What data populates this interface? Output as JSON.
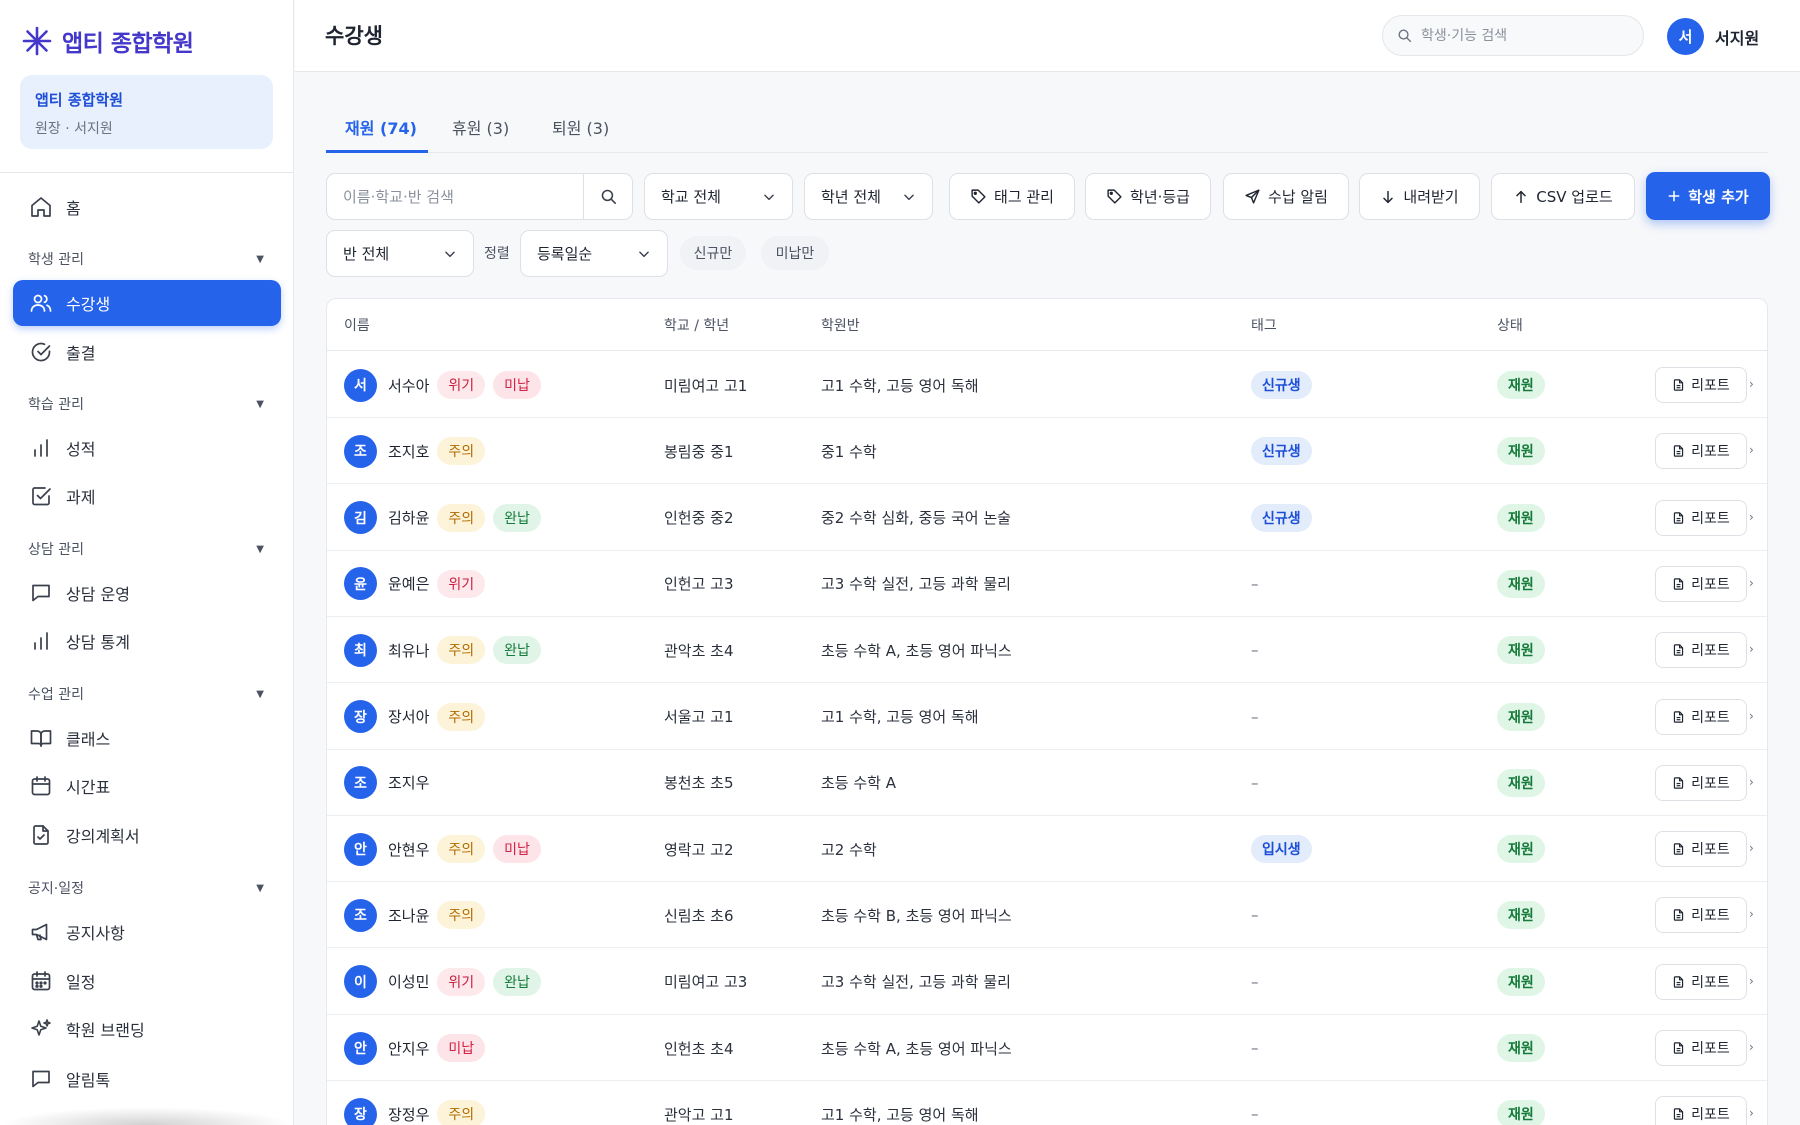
{
  "brand": {
    "name": "앱티 종합학원",
    "color": "#4338ca"
  },
  "accent": "#2563eb",
  "org_card": {
    "name": "앱티 종합학원",
    "role": "원장 · 서지원"
  },
  "sidebar": {
    "home": {
      "label": "홈",
      "icon": "home-icon"
    },
    "groups": [
      {
        "label": "학생 관리",
        "items": [
          {
            "label": "수강생",
            "icon": "users-icon",
            "active": true
          },
          {
            "label": "출결",
            "icon": "check-circle-icon"
          }
        ]
      },
      {
        "label": "학습 관리",
        "items": [
          {
            "label": "성적",
            "icon": "bar-chart-icon"
          },
          {
            "label": "과제",
            "icon": "checkbox-icon"
          }
        ]
      },
      {
        "label": "상담 관리",
        "items": [
          {
            "label": "상담 운영",
            "icon": "message-icon"
          },
          {
            "label": "상담 통계",
            "icon": "bar-chart-icon"
          }
        ]
      },
      {
        "label": "수업 관리",
        "items": [
          {
            "label": "클래스",
            "icon": "book-icon"
          },
          {
            "label": "시간표",
            "icon": "calendar-icon"
          },
          {
            "label": "강의계획서",
            "icon": "file-check-icon"
          }
        ]
      },
      {
        "label": "공지·일정",
        "items": [
          {
            "label": "공지사항",
            "icon": "megaphone-icon"
          },
          {
            "label": "일정",
            "icon": "calendar-grid-icon"
          },
          {
            "label": "학원 브랜딩",
            "icon": "sparkles-icon"
          },
          {
            "label": "알림톡",
            "icon": "message-icon"
          }
        ]
      }
    ]
  },
  "header": {
    "title": "수강생",
    "search_placeholder": "학생·기능 검색",
    "user": {
      "initial": "서",
      "name": "서지원"
    }
  },
  "tabs": [
    {
      "label": "재원 (74)",
      "active": true
    },
    {
      "label": "휴원 (3)"
    },
    {
      "label": "퇴원 (3)"
    }
  ],
  "toolbar": {
    "search_placeholder": "이름·학교·반 검색",
    "school_select": "학교 전체",
    "grade_select": "학년 전체",
    "tag_manage": "태그 관리",
    "grade_level": "학년·등급",
    "payment_notice": "수납 알림",
    "download": "내려받기",
    "csv_upload": "CSV 업로드",
    "add_student": "학생 추가",
    "class_select": "반 전체",
    "sort_label": "정렬",
    "sort_select": "등록일순",
    "chip_new": "신규만",
    "chip_unpaid": "미납만"
  },
  "table": {
    "headers": {
      "name": "이름",
      "school": "학교 / 학년",
      "classes": "학원반",
      "tag": "태그",
      "status": "상태"
    },
    "report_label": "리포트",
    "rows": [
      {
        "initial": "서",
        "name": "서수아",
        "badges": [
          {
            "text": "위기",
            "kind": "red"
          },
          {
            "text": "미납",
            "kind": "rose"
          }
        ],
        "school": "미림여고 고1",
        "classes": "고1 수학, 고등 영어 독해",
        "tag": "신규생",
        "status": "재원"
      },
      {
        "initial": "조",
        "name": "조지호",
        "badges": [
          {
            "text": "주의",
            "kind": "amber"
          }
        ],
        "school": "봉림중 중1",
        "classes": "중1 수학",
        "tag": "신규생",
        "status": "재원"
      },
      {
        "initial": "김",
        "name": "김하윤",
        "badges": [
          {
            "text": "주의",
            "kind": "amber"
          },
          {
            "text": "완납",
            "kind": "green"
          }
        ],
        "school": "인헌중 중2",
        "classes": "중2 수학 심화, 중등 국어 논술",
        "tag": "신규생",
        "status": "재원"
      },
      {
        "initial": "윤",
        "name": "윤예은",
        "badges": [
          {
            "text": "위기",
            "kind": "red"
          }
        ],
        "school": "인헌고 고3",
        "classes": "고3 수학 실전, 고등 과학 물리",
        "tag": "–",
        "status": "재원"
      },
      {
        "initial": "최",
        "name": "최유나",
        "badges": [
          {
            "text": "주의",
            "kind": "amber"
          },
          {
            "text": "완납",
            "kind": "green"
          }
        ],
        "school": "관악초 초4",
        "classes": "초등 수학 A, 초등 영어 파닉스",
        "tag": "–",
        "status": "재원"
      },
      {
        "initial": "장",
        "name": "장서아",
        "badges": [
          {
            "text": "주의",
            "kind": "amber"
          }
        ],
        "school": "서울고 고1",
        "classes": "고1 수학, 고등 영어 독해",
        "tag": "–",
        "status": "재원"
      },
      {
        "initial": "조",
        "name": "조지우",
        "badges": [],
        "school": "봉천초 초5",
        "classes": "초등 수학 A",
        "tag": "–",
        "status": "재원"
      },
      {
        "initial": "안",
        "name": "안현우",
        "badges": [
          {
            "text": "주의",
            "kind": "amber"
          },
          {
            "text": "미납",
            "kind": "rose"
          }
        ],
        "school": "영락고 고2",
        "classes": "고2 수학",
        "tag": "입시생",
        "status": "재원"
      },
      {
        "initial": "조",
        "name": "조나윤",
        "badges": [
          {
            "text": "주의",
            "kind": "amber"
          }
        ],
        "school": "신림초 초6",
        "classes": "초등 수학 B, 초등 영어 파닉스",
        "tag": "–",
        "status": "재원"
      },
      {
        "initial": "이",
        "name": "이성민",
        "badges": [
          {
            "text": "위기",
            "kind": "red"
          },
          {
            "text": "완납",
            "kind": "green"
          }
        ],
        "school": "미림여고 고3",
        "classes": "고3 수학 실전, 고등 과학 물리",
        "tag": "–",
        "status": "재원"
      },
      {
        "initial": "안",
        "name": "안지우",
        "badges": [
          {
            "text": "미납",
            "kind": "rose"
          }
        ],
        "school": "인헌초 초4",
        "classes": "초등 수학 A, 초등 영어 파닉스",
        "tag": "–",
        "status": "재원"
      },
      {
        "initial": "장",
        "name": "장정우",
        "badges": [
          {
            "text": "주의",
            "kind": "amber"
          }
        ],
        "school": "관악고 고1",
        "classes": "고1 수학, 고등 영어 독해",
        "tag": "–",
        "status": "재원"
      }
    ]
  }
}
